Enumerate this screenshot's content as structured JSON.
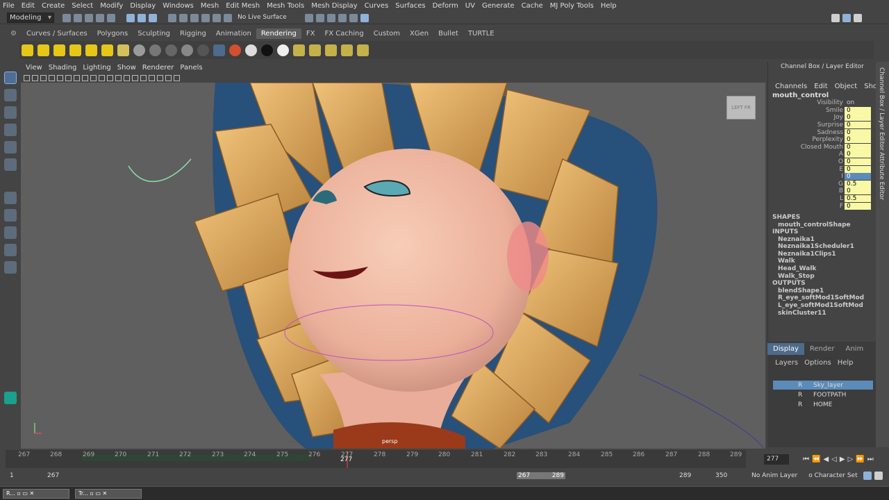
{
  "menubar": {
    "items": [
      "File",
      "Edit",
      "Create",
      "Select",
      "Modify",
      "Display",
      "Windows",
      "Mesh",
      "Edit Mesh",
      "Mesh Tools",
      "Mesh Display",
      "Curves",
      "Surfaces",
      "Deform",
      "UV",
      "Generate",
      "Cache",
      "MJ Poly Tools",
      "Help"
    ]
  },
  "status": {
    "mode": "Modeling",
    "live_surface": "No Live Surface"
  },
  "shelf_tabs": [
    {
      "label": "Curves / Surfaces"
    },
    {
      "label": "Polygons"
    },
    {
      "label": "Sculpting"
    },
    {
      "label": "Rigging"
    },
    {
      "label": "Animation"
    },
    {
      "label": "Rendering",
      "active": true
    },
    {
      "label": "FX"
    },
    {
      "label": "FX Caching"
    },
    {
      "label": "Custom"
    },
    {
      "label": "XGen"
    },
    {
      "label": "Bullet"
    },
    {
      "label": "TURTLE"
    }
  ],
  "panel_menu": [
    "View",
    "Shading",
    "Lighting",
    "Show",
    "Renderer",
    "Panels"
  ],
  "viewport": {
    "camera_label": "persp",
    "viewcube_left": "LEFT",
    "viewcube_front": "FR"
  },
  "channel_box": {
    "title": "Channel Box / Layer Editor",
    "menu": [
      "Channels",
      "Edit",
      "Object",
      "Show"
    ],
    "object": "mouth_control",
    "attributes": [
      {
        "name": "Visibility",
        "value": "on",
        "style": "plain"
      },
      {
        "name": "Smile",
        "value": "0"
      },
      {
        "name": "Joy",
        "value": "0"
      },
      {
        "name": "Surprise",
        "value": "0"
      },
      {
        "name": "Sadness",
        "value": "0"
      },
      {
        "name": "Perplexity",
        "value": "0"
      },
      {
        "name": "Closed Mouth",
        "value": "0"
      },
      {
        "name": "A",
        "value": "0"
      },
      {
        "name": "O",
        "value": "0"
      },
      {
        "name": "E",
        "value": "0"
      },
      {
        "name": "I",
        "value": "0",
        "style": "hi"
      },
      {
        "name": "G",
        "value": "0.5"
      },
      {
        "name": "B",
        "value": "0"
      },
      {
        "name": "L",
        "value": "0.5"
      },
      {
        "name": "F",
        "value": "0"
      }
    ],
    "shapes_label": "SHAPES",
    "shapes": [
      "mouth_controlShape"
    ],
    "inputs_label": "INPUTS",
    "inputs": [
      "Neznaika1",
      "Neznaika1Scheduler1",
      "Neznaika1Clips1",
      "Walk",
      "Head_Walk",
      "Walk_Stop"
    ],
    "outputs_label": "OUTPUTS",
    "outputs": [
      "blendShape1",
      "R_eye_softMod1SoftMod",
      "L_eye_softMod1SoftMod",
      "skinCluster11"
    ]
  },
  "side_tabs": {
    "channel_box": "Channel Box / Layer Editor",
    "attribute_editor": "Attribute Editor"
  },
  "layer_editor": {
    "tabs": [
      {
        "label": "Display",
        "active": true
      },
      {
        "label": "Render"
      },
      {
        "label": "Anim"
      }
    ],
    "menu": [
      "Layers",
      "Options",
      "Help"
    ],
    "layers": [
      {
        "name": "Sky_layer",
        "flag": "R",
        "selected": true
      },
      {
        "name": "FOOTPATH",
        "flag": "R"
      },
      {
        "name": "HOME",
        "flag": "R"
      }
    ]
  },
  "timeline": {
    "ticks": [
      "267",
      "268",
      "269",
      "270",
      "271",
      "272",
      "273",
      "274",
      "275",
      "276",
      "277",
      "278",
      "279",
      "280",
      "281",
      "282",
      "283",
      "284",
      "285",
      "286",
      "287",
      "288",
      "289"
    ],
    "current_frame": "277",
    "current_frame_field": "277"
  },
  "range": {
    "start": "1",
    "anim_start": "267",
    "range_start": "267",
    "range_end": "289",
    "anim_end": "289",
    "end": "350",
    "anim_layer": "No Anim Layer",
    "char_set": "o Character Set"
  },
  "taskbar": {
    "items": [
      "R...",
      "Tr..."
    ]
  }
}
